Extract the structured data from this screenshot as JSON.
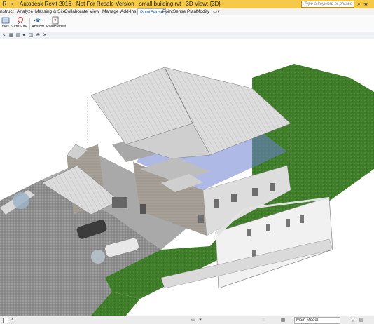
{
  "window": {
    "title": "Autodesk Revit 2016 - Not For Resale Version -     small building.rvt - 3D View: {3D}",
    "search_placeholder": "Type a keyword or phrase"
  },
  "tabs": [
    {
      "label": "nstruct"
    },
    {
      "label": "Analyze"
    },
    {
      "label": "Massing & Site"
    },
    {
      "label": "Collaborate"
    },
    {
      "label": "View"
    },
    {
      "label": "Manage"
    },
    {
      "label": "Add-Ins"
    },
    {
      "label": "PointSense"
    },
    {
      "label": "PointSense Plant"
    },
    {
      "label": "Modify"
    }
  ],
  "active_tab": "PointSense",
  "ribbon": {
    "buttons": [
      {
        "label": "tiles",
        "icon": "tiles-icon"
      },
      {
        "label": "VirtuSurv...",
        "icon": "virtusurvey-icon"
      },
      {
        "label": "Ansicht",
        "icon": "ansicht-icon"
      },
      {
        "label": "PointSense",
        "icon": "pointsense-icon"
      }
    ]
  },
  "status": {
    "scale": "4",
    "model": "Main Model"
  },
  "colors": {
    "titlebar": "#f7c948",
    "grass": "#3f7d2a",
    "roof": "#d7d7d7",
    "glass": "#6c7fd1"
  }
}
